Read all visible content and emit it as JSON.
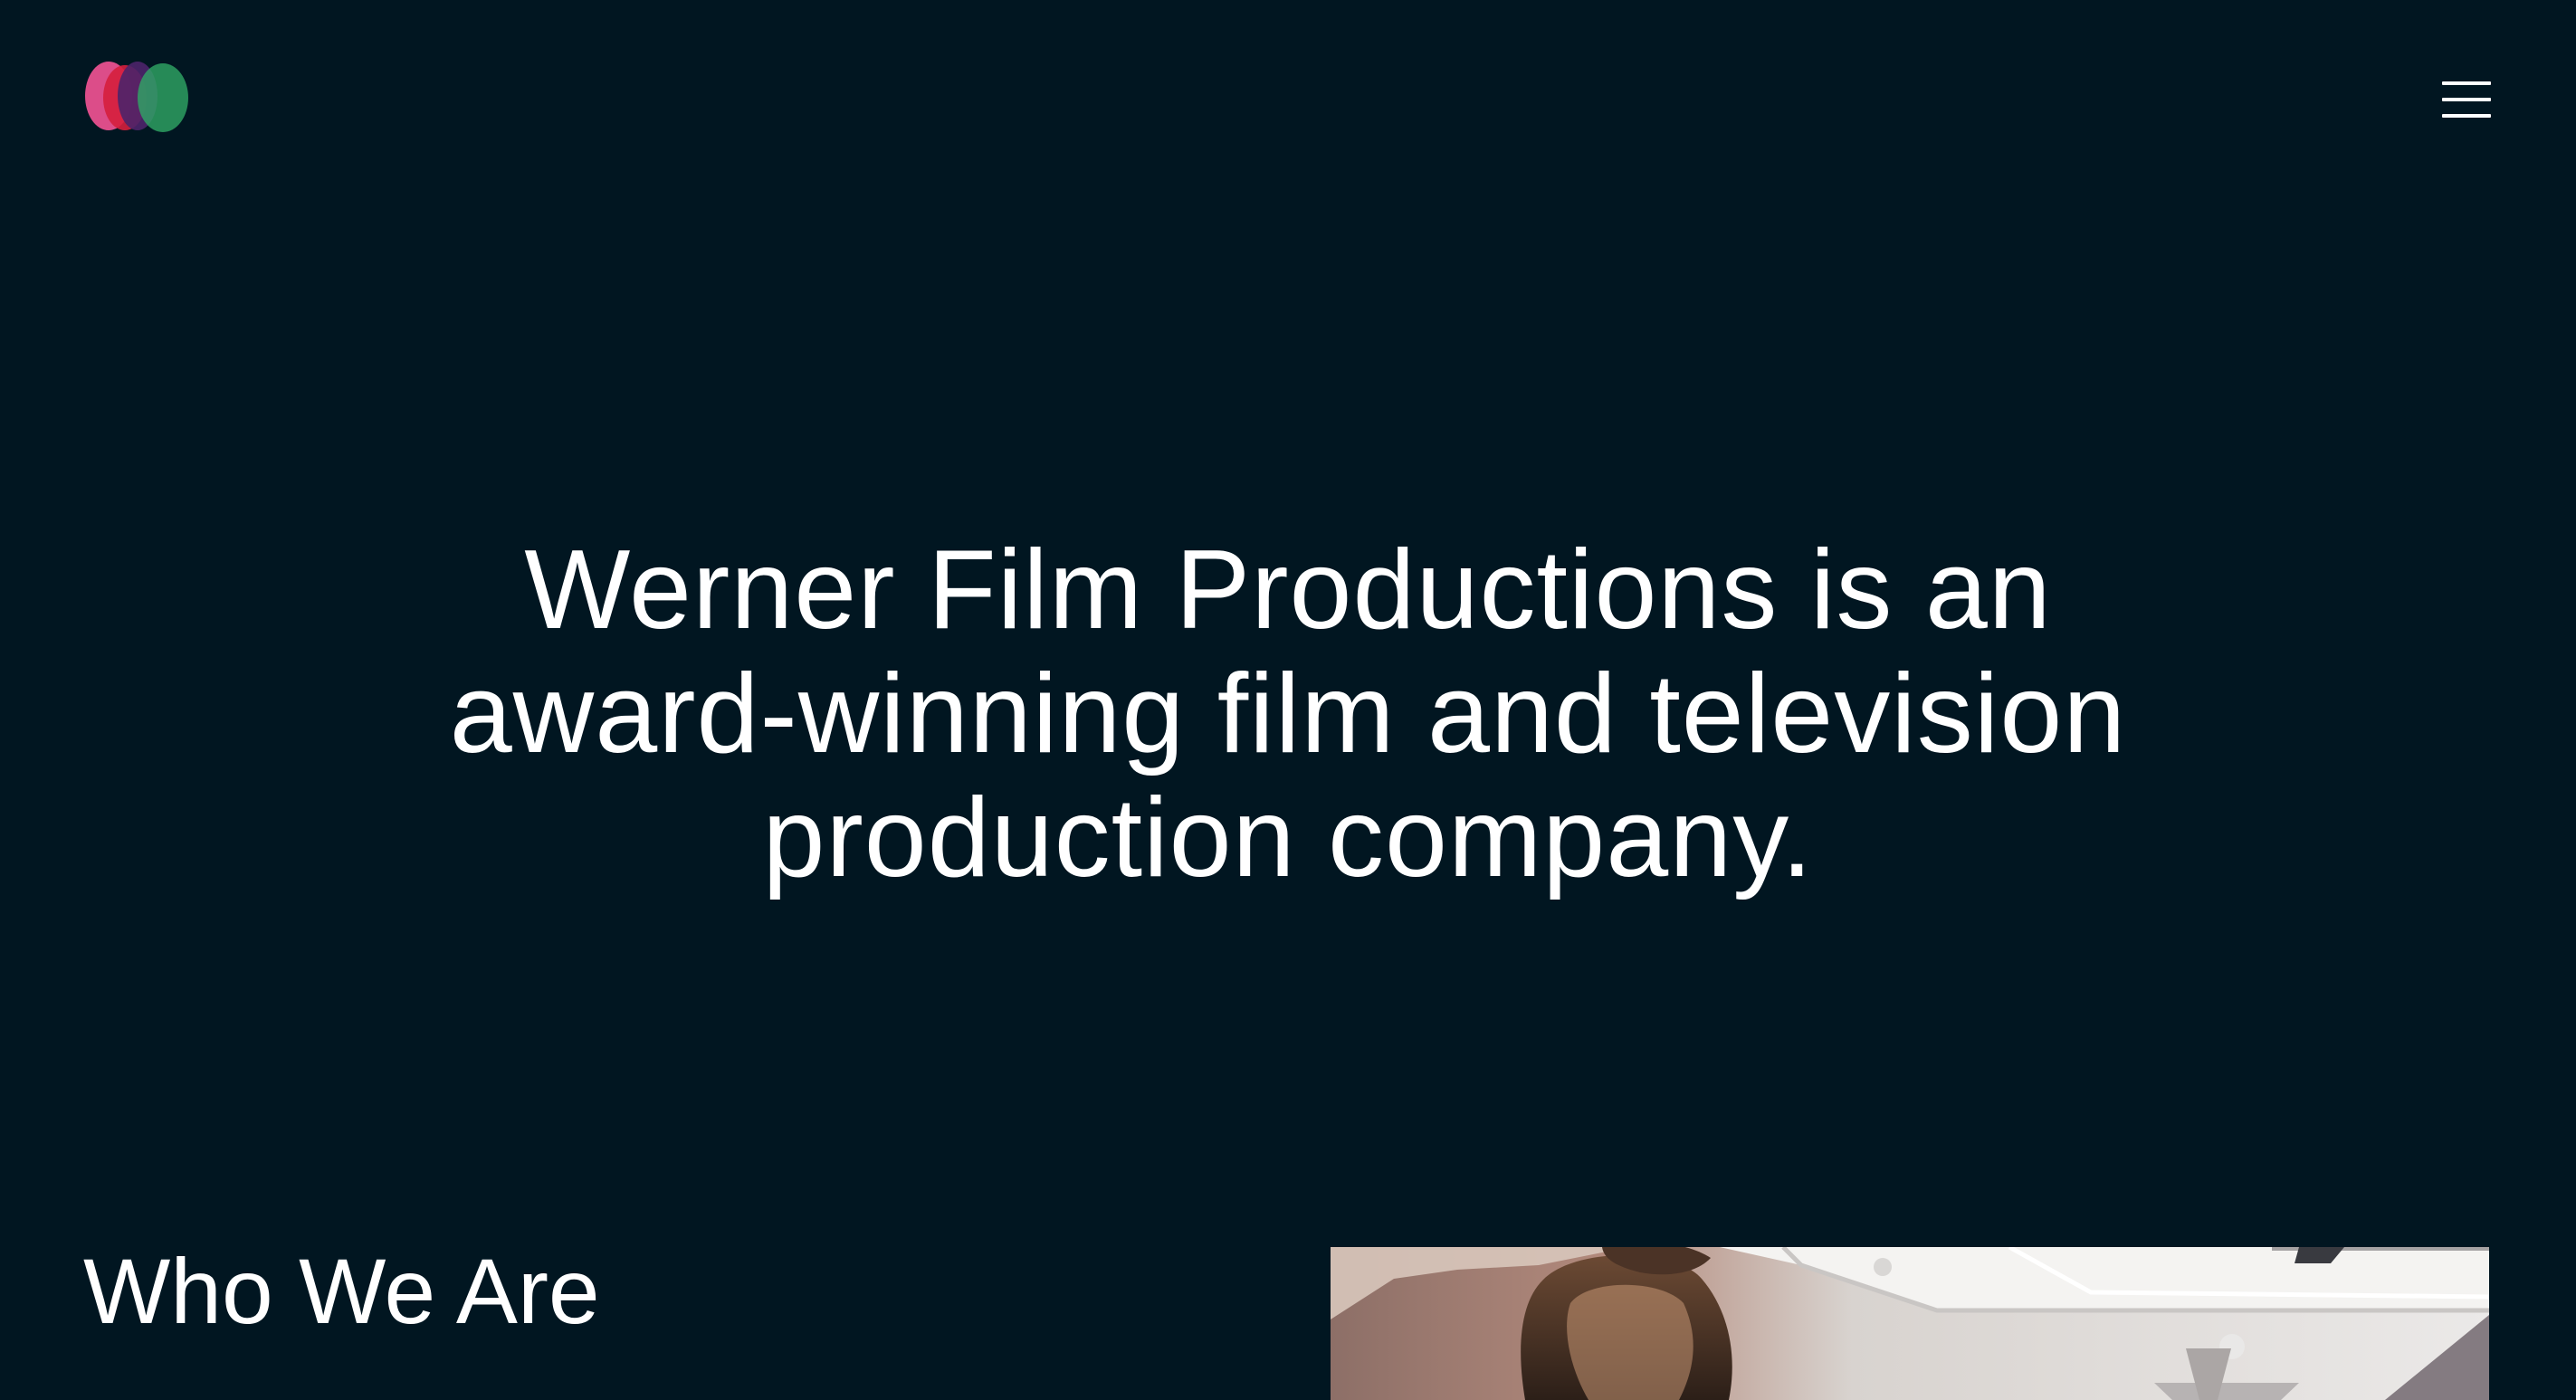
{
  "header": {
    "logo_name": "werner-film-productions-logo",
    "menu_icon": "hamburger-menu-icon"
  },
  "hero": {
    "headline": "Werner Film Productions is an award-winning film and television production company."
  },
  "about": {
    "title": "Who We Are",
    "image_description_icon": "photo"
  },
  "colors": {
    "background": "#011621",
    "text": "#ffffff",
    "logo_pink": "#e8508f",
    "logo_red": "#d51f3d",
    "logo_purple": "#4c236a",
    "logo_green": "#2fa865"
  }
}
